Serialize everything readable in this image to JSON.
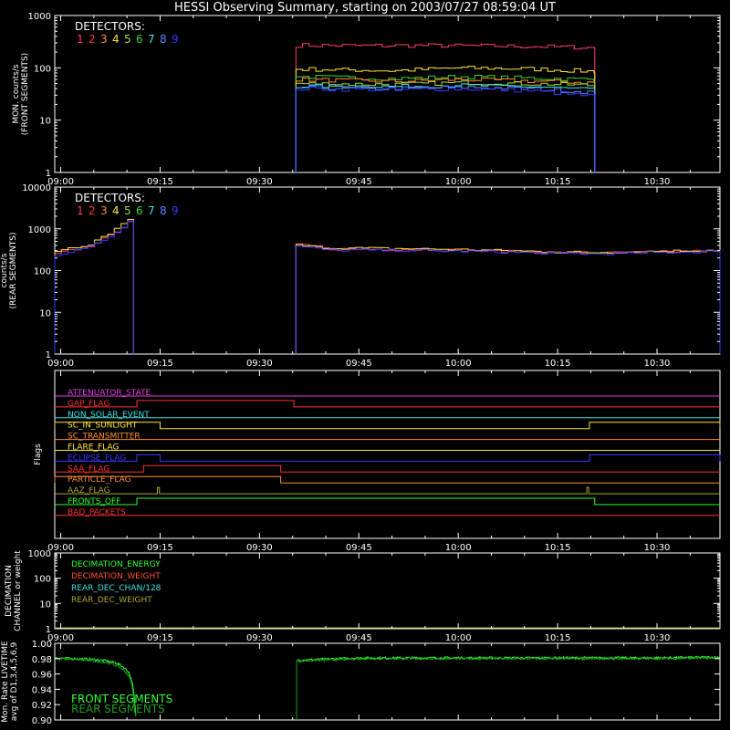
{
  "title": "HESSI Observing Summary, starting on 2003/07/27 08:59:04 UT",
  "time_ticks": [
    "09:00",
    "09:15",
    "09:30",
    "09:45",
    "10:00",
    "10:15",
    "10:30"
  ],
  "detectors_label": "DETECTORS:",
  "detector_numbers": [
    "1",
    "2",
    "3",
    "4",
    "5",
    "6",
    "7",
    "8",
    "9"
  ],
  "colors": {
    "det": [
      "#ff3c6e",
      "#ff3030",
      "#ff9030",
      "#ffe838",
      "#a8d838",
      "#38d838",
      "#38e8e8",
      "#5888ff",
      "#3838ff"
    ],
    "frame": "#ffffff",
    "front": "#30ff30",
    "rear": "#20a020"
  },
  "chart_data": [
    {
      "type": "line",
      "panel": "front",
      "ylabel": [
        "MON. counts/s",
        "(FRONT SEGMENTS)"
      ],
      "ylim": [
        1,
        1000
      ],
      "log": true,
      "yticks": [
        "1",
        "10",
        "100",
        "1000"
      ],
      "x_unit": "minutes after 09:00",
      "xlim": [
        -0.9,
        99.5
      ],
      "active_intervals": [
        [
          35.5,
          80.6
        ]
      ],
      "series": [
        {
          "det": 1,
          "values": [
            [
              35.5,
              270
            ],
            [
              45,
              265
            ],
            [
              55,
              268
            ],
            [
              65,
              262
            ],
            [
              72,
              255
            ],
            [
              78,
              248
            ],
            [
              80.6,
              240
            ]
          ]
        },
        {
          "det": 4,
          "values": [
            [
              35.5,
              95
            ],
            [
              50,
              88
            ],
            [
              60,
              100
            ],
            [
              70,
              96
            ],
            [
              80.6,
              85
            ]
          ]
        },
        {
          "det": 6,
          "values": [
            [
              35.5,
              68
            ],
            [
              50,
              62
            ],
            [
              60,
              68
            ],
            [
              70,
              64
            ],
            [
              80.6,
              60
            ]
          ]
        },
        {
          "det": 3,
          "values": [
            [
              35.5,
              60
            ],
            [
              50,
              55
            ],
            [
              60,
              60
            ],
            [
              70,
              56
            ],
            [
              80.6,
              52
            ]
          ]
        },
        {
          "det": 5,
          "values": [
            [
              35.5,
              50
            ],
            [
              50,
              48
            ],
            [
              60,
              52
            ],
            [
              70,
              50
            ],
            [
              80.6,
              46
            ]
          ]
        },
        {
          "det": 7,
          "values": [
            [
              35.5,
              45
            ],
            [
              50,
              44
            ],
            [
              60,
              46
            ],
            [
              70,
              44
            ],
            [
              80.6,
              38
            ]
          ]
        },
        {
          "det": 8,
          "values": [
            [
              35.5,
              42
            ],
            [
              50,
              40
            ],
            [
              60,
              43
            ],
            [
              70,
              40
            ],
            [
              80.6,
              34
            ]
          ]
        },
        {
          "det": 9,
          "values": [
            [
              35.5,
              40
            ],
            [
              50,
              38
            ],
            [
              60,
              40
            ],
            [
              70,
              37
            ],
            [
              80.6,
              28
            ]
          ]
        }
      ]
    },
    {
      "type": "line",
      "panel": "rear",
      "ylabel": [
        "counts/s",
        "(REAR SEGMENTS)"
      ],
      "ylim": [
        1,
        10000
      ],
      "log": true,
      "yticks": [
        "1",
        "10",
        "100",
        "1000",
        "10000"
      ],
      "x_unit": "minutes after 09:00",
      "xlim": [
        -0.9,
        99.5
      ],
      "active_intervals": [
        [
          -0.9,
          11.0
        ],
        [
          35.5,
          99.5
        ]
      ],
      "series": [
        {
          "det": 1,
          "values": [
            [
              -0.9,
              250
            ],
            [
              4,
              380
            ],
            [
              7,
              650
            ],
            [
              9,
              1100
            ],
            [
              10.5,
              1700
            ],
            [
              11,
              900
            ]
          ]
        },
        {
          "det": 4,
          "values": [
            [
              -0.9,
              270
            ],
            [
              4,
              420
            ],
            [
              7,
              750
            ],
            [
              9,
              1300
            ],
            [
              10.5,
              1900
            ],
            [
              11,
              950
            ]
          ]
        },
        {
          "det": 9,
          "values": [
            [
              -0.9,
              240
            ],
            [
              4,
              360
            ],
            [
              7,
              600
            ],
            [
              9,
              1000
            ],
            [
              10.5,
              1600
            ],
            [
              11,
              850
            ]
          ]
        },
        {
          "det": 1,
          "values": [
            [
              35.5,
              420
            ],
            [
              40,
              330
            ],
            [
              55,
              320
            ],
            [
              70,
              280
            ],
            [
              80,
              260
            ],
            [
              90,
              280
            ],
            [
              99.5,
              300
            ]
          ]
        },
        {
          "det": 4,
          "values": [
            [
              35.5,
              400
            ],
            [
              40,
              350
            ],
            [
              55,
              330
            ],
            [
              70,
              290
            ],
            [
              80,
              270
            ],
            [
              90,
              290
            ],
            [
              99.5,
              310
            ]
          ]
        },
        {
          "det": 9,
          "values": [
            [
              35.5,
              380
            ],
            [
              40,
              310
            ],
            [
              55,
              300
            ],
            [
              70,
              270
            ],
            [
              80,
              250
            ],
            [
              90,
              270
            ],
            [
              99.5,
              290
            ]
          ]
        }
      ]
    },
    {
      "type": "line",
      "panel": "flags",
      "ylabel": [
        "Flags"
      ],
      "x_unit": "minutes after 09:00",
      "xlim": [
        -0.9,
        99.5
      ],
      "flags": [
        {
          "name": "ATTENUATOR_STATE",
          "color": "#e040e0",
          "high": []
        },
        {
          "name": "GAP_FLAG",
          "color": "#ff3030",
          "high": [
            [
              11.5,
              35.2
            ]
          ]
        },
        {
          "name": "NON_SOLAR_EVENT",
          "color": "#40e0e0",
          "high": []
        },
        {
          "name": "SC_IN_SUNLIGHT",
          "color": "#ffe838",
          "high": [
            [
              -0.9,
              15.0
            ],
            [
              79.8,
              99.5
            ]
          ]
        },
        {
          "name": "SC_TRANSMITTER",
          "color": "#ff9030",
          "high": []
        },
        {
          "name": "FLARE_FLAG",
          "color": "#ffe838",
          "high": []
        },
        {
          "name": "ECLIPSE_FLAG",
          "color": "#3838ff",
          "high": [
            [
              11.5,
              15.0
            ],
            [
              79.8,
              99.5
            ]
          ]
        },
        {
          "name": "SAA_FLAG",
          "color": "#ff3030",
          "high": [
            [
              12.5,
              33.2
            ]
          ]
        },
        {
          "name": "PARTICLE_FLAG",
          "color": "#ff9030",
          "high": [
            [
              -0.9,
              33.2
            ]
          ]
        },
        {
          "name": "AAZ_FLAG",
          "color": "#a8a830",
          "high": [
            [
              14.6,
              14.9
            ],
            [
              79.4,
              79.7
            ]
          ]
        },
        {
          "name": "FRONTS_OFF",
          "color": "#30ff30",
          "high": [
            [
              11.5,
              80.6
            ]
          ]
        },
        {
          "name": "BAD_PACKETS",
          "color": "#ff3030",
          "high": []
        }
      ]
    },
    {
      "type": "line",
      "panel": "decimation",
      "ylabel": [
        "DECIMATION",
        "CHANNEL or weight"
      ],
      "ylim": [
        1,
        1000
      ],
      "log": true,
      "yticks": [
        "1",
        "10",
        "100",
        "1000"
      ],
      "x_unit": "minutes after 09:00",
      "xlim": [
        -0.9,
        99.5
      ],
      "series": [
        {
          "name": "DECIMATION_ENERGY",
          "color": "#30ff30",
          "values": []
        },
        {
          "name": "DECIMATION_WEIGHT",
          "color": "#ff5030",
          "values": []
        },
        {
          "name": "REAR_DEC_CHAN/128",
          "color": "#40e0e0",
          "values": []
        },
        {
          "name": "REAR_DEC_WEIGHT",
          "color": "#a8a830",
          "values": [
            [
              -0.9,
              1
            ],
            [
              99.5,
              1
            ]
          ]
        }
      ]
    },
    {
      "type": "line",
      "panel": "livetime",
      "ylabel": [
        "Mon. Rate LIVETIME",
        "avg of D1,3,4,5,6,9"
      ],
      "ylim": [
        0.9,
        1.0
      ],
      "log": false,
      "yticks": [
        "0.90",
        "0.92",
        "0.94",
        "0.96",
        "0.98",
        "1.00"
      ],
      "x_unit": "minutes after 09:00",
      "xlim": [
        -0.9,
        99.5
      ],
      "series": [
        {
          "name": "FRONT SEGMENTS",
          "color": "#30ff30",
          "values": [
            [
              -0.9,
              0.981
            ],
            [
              2,
              0.98
            ],
            [
              5,
              0.979
            ],
            [
              7,
              0.977
            ],
            [
              8.5,
              0.974
            ],
            [
              9.5,
              0.969
            ],
            [
              10.3,
              0.962
            ],
            [
              10.8,
              0.95
            ],
            [
              11.1,
              0.93
            ],
            [
              11.4,
              0.9
            ],
            [
              35.5,
              0.9
            ],
            [
              35.7,
              0.978
            ],
            [
              45,
              0.981
            ],
            [
              60,
              0.981
            ],
            [
              75,
              0.981
            ],
            [
              90,
              0.981
            ],
            [
              99.5,
              0.982
            ]
          ]
        },
        {
          "name": "REAR SEGMENTS",
          "color": "#20a020",
          "values": [
            [
              -0.9,
              0.98
            ],
            [
              2,
              0.979
            ],
            [
              5,
              0.977
            ],
            [
              7,
              0.975
            ],
            [
              8.5,
              0.971
            ],
            [
              9.5,
              0.965
            ],
            [
              10.3,
              0.957
            ],
            [
              10.8,
              0.944
            ],
            [
              11.1,
              0.92
            ],
            [
              11.4,
              0.9
            ],
            [
              35.5,
              0.9
            ],
            [
              35.7,
              0.977
            ],
            [
              45,
              0.98
            ],
            [
              60,
              0.98
            ],
            [
              75,
              0.98
            ],
            [
              90,
              0.98
            ],
            [
              99.5,
              0.981
            ]
          ]
        }
      ]
    }
  ]
}
